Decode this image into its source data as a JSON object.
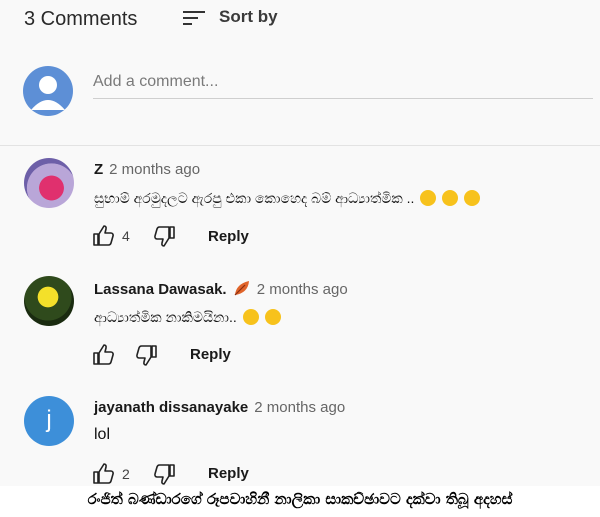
{
  "header": {
    "count_label": "3 Comments",
    "sort_label": "Sort by"
  },
  "add_comment": {
    "placeholder": "Add a comment..."
  },
  "comments": [
    {
      "author": "Z",
      "time": "2 months ago",
      "text": "සුභාම් අරමුදලට ඇරපු එකා කොහෙද බම් ආධ්‍යාත්මික ..",
      "likes": "4",
      "reply_label": "Reply"
    },
    {
      "author": "Lassana Dawasak.",
      "time": "2 months ago",
      "text": "ආධ්‍යාත්මික නාකිමයිනා..",
      "likes": "",
      "reply_label": "Reply"
    },
    {
      "author": "jayanath dissanayake",
      "time": "2 months ago",
      "avatar_letter": "j",
      "text": "lol",
      "likes": "2",
      "reply_label": "Reply"
    }
  ],
  "caption": "රංජිත් බණ්ඩාරගේ රූපවාහිනී නාලිකා සාකච්ඡාවට දක්වා තිබූ අදහස්",
  "colors": {
    "me_avatar": "#5d8fd6",
    "j_avatar": "#3d8fd9",
    "emoji": "#f7c21c"
  }
}
